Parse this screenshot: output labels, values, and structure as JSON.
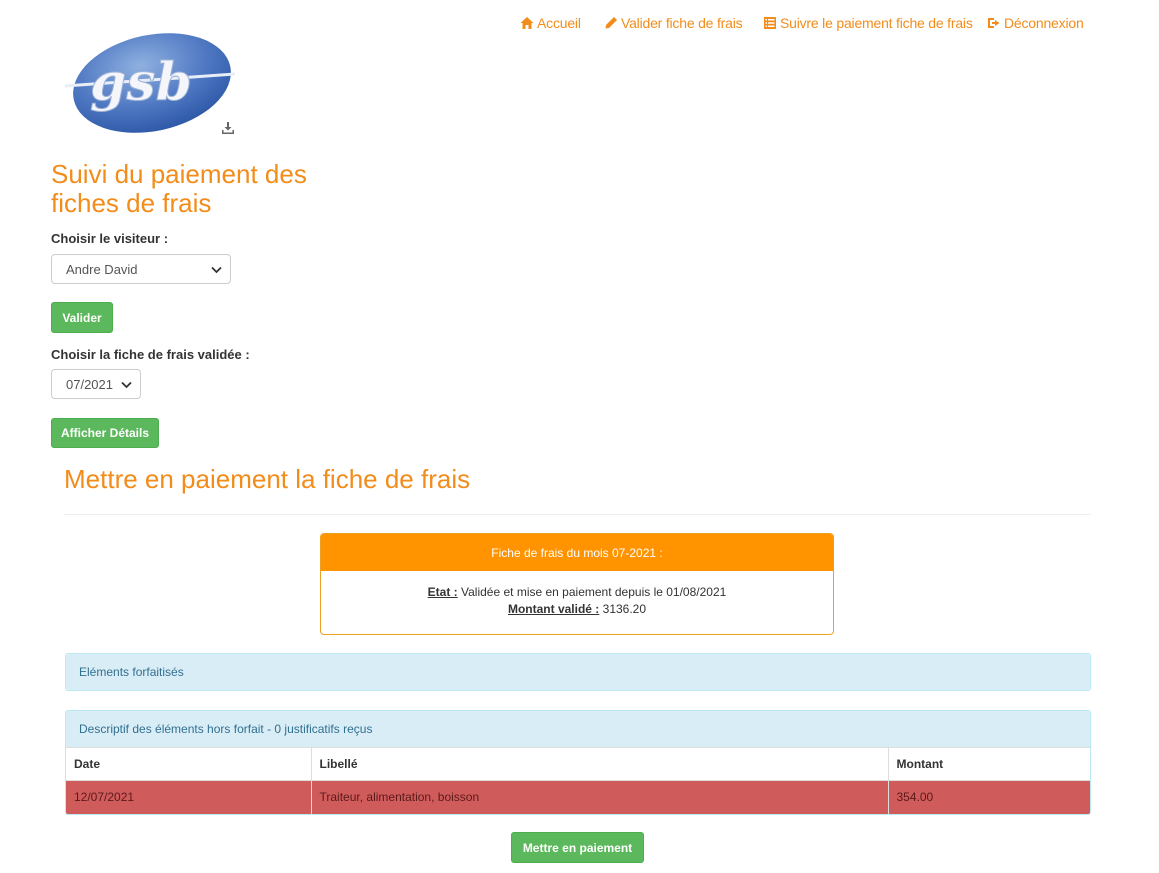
{
  "nav": {
    "items": [
      {
        "label": "Accueil",
        "icon": "home-icon"
      },
      {
        "label": "Valider fiche de frais",
        "icon": "pencil-icon"
      },
      {
        "label": "Suivre le paiement fiche de frais",
        "icon": "list-alt-icon"
      },
      {
        "label": "Déconnexion",
        "icon": "log-out-icon"
      }
    ]
  },
  "logo": {
    "text": "gsb"
  },
  "page_title": "Suivi du paiement des fiches de frais",
  "form": {
    "visiteur_label": "Choisir le visiteur :",
    "visiteur_value": "Andre David",
    "valider_label": "Valider",
    "fiche_label": "Choisir la fiche de frais validée :",
    "fiche_value": "07/2021",
    "details_label": "Afficher Détails"
  },
  "section_title": "Mettre en paiement la fiche de frais",
  "fiche": {
    "heading": "Fiche de frais du mois 07-2021 :",
    "etat_key": "Etat :",
    "etat_value": "Validée et mise en paiement depuis le 01/08/2021",
    "montant_key": "Montant validé :",
    "montant_value": "3136.20"
  },
  "forfait_panel": {
    "heading": "Eléments forfaitisés"
  },
  "horsforfait_panel": {
    "heading": "Descriptif des éléments hors forfait - 0 justificatifs reçus",
    "columns": [
      "Date",
      "Libellé",
      "Montant"
    ],
    "rows": [
      {
        "date": "12/07/2021",
        "libelle": "Traiteur, alimentation, boisson",
        "montant": "354.00"
      }
    ]
  },
  "pay_button_label": "Mettre en paiement",
  "colors": {
    "accent": "#f28c1b",
    "success": "#5cb85c",
    "refused_row": "#d05b5b",
    "fiche_header": "#ff9300",
    "panel_info": "#d9edf7"
  }
}
